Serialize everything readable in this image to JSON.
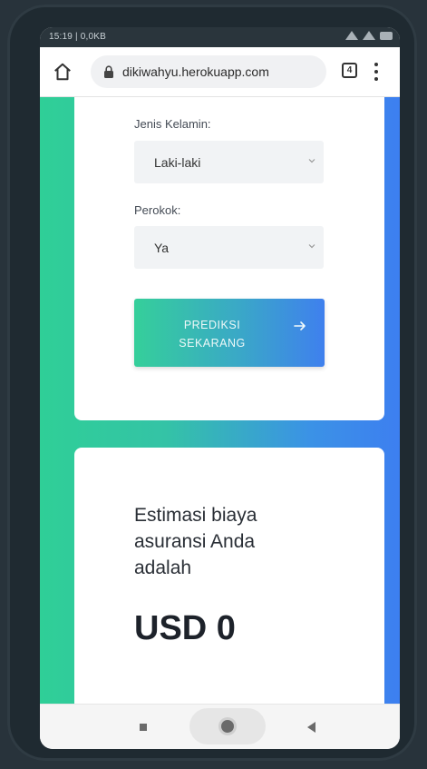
{
  "status_bar": {
    "time": "15:19 | 0,0KB"
  },
  "browser": {
    "url": "dikiwahyu.herokuapp.com",
    "tab_count": "4"
  },
  "form": {
    "gender_label": "Jenis Kelamin:",
    "gender_value": "Laki-laki",
    "smoker_label": "Perokok:",
    "smoker_value": "Ya",
    "submit_line1": "PREDIKSI",
    "submit_line2": "SEKARANG"
  },
  "result": {
    "heading": "Estimasi biaya asuransi Anda adalah",
    "amount": "USD 0"
  },
  "icons": {
    "home": "home-icon",
    "lock": "lock-icon",
    "tabs": "tabs-icon",
    "menu": "more-vert-icon",
    "chevron": "chevron-down-icon",
    "arrow": "arrow-right-icon",
    "nav_recent": "square-icon",
    "nav_home": "circle-icon",
    "nav_back": "back-triangle-icon"
  },
  "colors": {
    "gradient_start": "#2fcf97",
    "gradient_end": "#3d7ff0",
    "card": "#ffffff",
    "text_dark": "#1d222a"
  }
}
